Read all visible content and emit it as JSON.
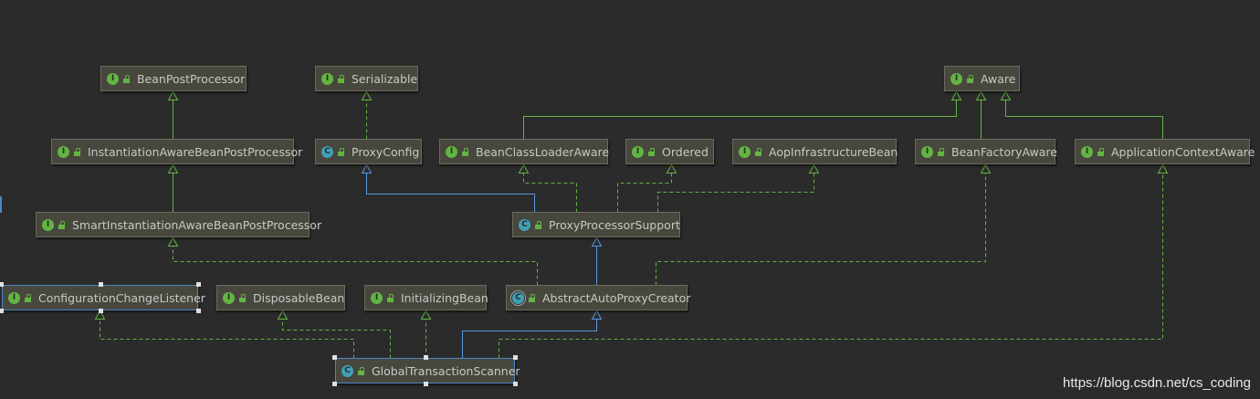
{
  "colors": {
    "background": "#2b2b2b",
    "node_fill": "#47473d",
    "extends_edge": "#5c95e0",
    "implements_edge": "#62b543",
    "selection": "#4a88c7"
  },
  "nodes": [
    {
      "id": "BeanPostProcessor",
      "label": "BeanPostProcessor",
      "kind": "interface"
    },
    {
      "id": "Serializable",
      "label": "Serializable",
      "kind": "interface"
    },
    {
      "id": "Aware",
      "label": "Aware",
      "kind": "interface"
    },
    {
      "id": "InstantiationAwareBeanPostProcessor",
      "label": "InstantiationAwareBeanPostProcessor",
      "kind": "interface"
    },
    {
      "id": "ProxyConfig",
      "label": "ProxyConfig",
      "kind": "class"
    },
    {
      "id": "BeanClassLoaderAware",
      "label": "BeanClassLoaderAware",
      "kind": "interface"
    },
    {
      "id": "Ordered",
      "label": "Ordered",
      "kind": "interface"
    },
    {
      "id": "AopInfrastructureBean",
      "label": "AopInfrastructureBean",
      "kind": "interface"
    },
    {
      "id": "BeanFactoryAware",
      "label": "BeanFactoryAware",
      "kind": "interface"
    },
    {
      "id": "ApplicationContextAware",
      "label": "ApplicationContextAware",
      "kind": "interface"
    },
    {
      "id": "SmartInstantiationAwareBeanPostProcessor",
      "label": "SmartInstantiationAwareBeanPostProcessor",
      "kind": "interface"
    },
    {
      "id": "ProxyProcessorSupport",
      "label": "ProxyProcessorSupport",
      "kind": "class"
    },
    {
      "id": "ConfigurationChangeListener",
      "label": "ConfigurationChangeListener",
      "kind": "interface",
      "selected": true
    },
    {
      "id": "DisposableBean",
      "label": "DisposableBean",
      "kind": "interface"
    },
    {
      "id": "InitializingBean",
      "label": "InitializingBean",
      "kind": "interface"
    },
    {
      "id": "AbstractAutoProxyCreator",
      "label": "AbstractAutoProxyCreator",
      "kind": "abstract"
    },
    {
      "id": "GlobalTransactionScanner",
      "label": "GlobalTransactionScanner",
      "kind": "class",
      "selected": true
    }
  ],
  "edges": [
    {
      "from": "InstantiationAwareBeanPostProcessor",
      "to": "BeanPostProcessor",
      "type": "extends-interface"
    },
    {
      "from": "SmartInstantiationAwareBeanPostProcessor",
      "to": "InstantiationAwareBeanPostProcessor",
      "type": "extends-interface"
    },
    {
      "from": "ProxyConfig",
      "to": "Serializable",
      "type": "implements"
    },
    {
      "from": "BeanClassLoaderAware",
      "to": "Aware",
      "type": "extends-interface"
    },
    {
      "from": "BeanFactoryAware",
      "to": "Aware",
      "type": "extends-interface"
    },
    {
      "from": "ApplicationContextAware",
      "to": "Aware",
      "type": "extends-interface"
    },
    {
      "from": "ProxyProcessorSupport",
      "to": "ProxyConfig",
      "type": "extends"
    },
    {
      "from": "ProxyProcessorSupport",
      "to": "BeanClassLoaderAware",
      "type": "implements"
    },
    {
      "from": "ProxyProcessorSupport",
      "to": "Ordered",
      "type": "implements"
    },
    {
      "from": "ProxyProcessorSupport",
      "to": "AopInfrastructureBean",
      "type": "implements"
    },
    {
      "from": "AbstractAutoProxyCreator",
      "to": "ProxyProcessorSupport",
      "type": "extends"
    },
    {
      "from": "AbstractAutoProxyCreator",
      "to": "SmartInstantiationAwareBeanPostProcessor",
      "type": "implements"
    },
    {
      "from": "AbstractAutoProxyCreator",
      "to": "BeanFactoryAware",
      "type": "implements"
    },
    {
      "from": "GlobalTransactionScanner",
      "to": "AbstractAutoProxyCreator",
      "type": "extends"
    },
    {
      "from": "GlobalTransactionScanner",
      "to": "ConfigurationChangeListener",
      "type": "implements"
    },
    {
      "from": "GlobalTransactionScanner",
      "to": "DisposableBean",
      "type": "implements"
    },
    {
      "from": "GlobalTransactionScanner",
      "to": "InitializingBean",
      "type": "implements"
    },
    {
      "from": "GlobalTransactionScanner",
      "to": "ApplicationContextAware",
      "type": "implements"
    }
  ],
  "watermark": "https://blog.csdn.net/cs_coding"
}
